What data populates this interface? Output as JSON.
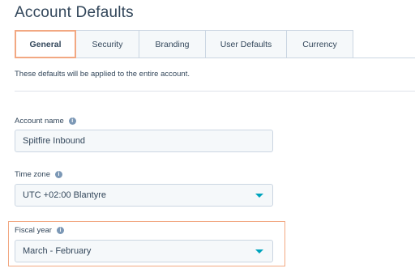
{
  "page": {
    "title": "Account Defaults"
  },
  "tabs": [
    {
      "label": "General",
      "active": true
    },
    {
      "label": "Security",
      "active": false
    },
    {
      "label": "Branding",
      "active": false
    },
    {
      "label": "User Defaults",
      "active": false
    },
    {
      "label": "Currency",
      "active": false
    }
  ],
  "intro_text": "These defaults will be applied to the entire account.",
  "fields": {
    "account_name": {
      "label": "Account name",
      "value": "Spitfire Inbound",
      "info_icon": "info-icon"
    },
    "time_zone": {
      "label": "Time zone",
      "value": "UTC +02:00 Blantyre",
      "info_icon": "info-icon"
    },
    "fiscal_year": {
      "label": "Fiscal year",
      "value": "March - February",
      "info_icon": "info-icon"
    }
  },
  "colors": {
    "accent_highlight": "#f2a882",
    "dropdown_caret": "#00a4bd",
    "text": "#33475b",
    "input_bg": "#f5f8fa",
    "border": "#cbd6e2"
  }
}
